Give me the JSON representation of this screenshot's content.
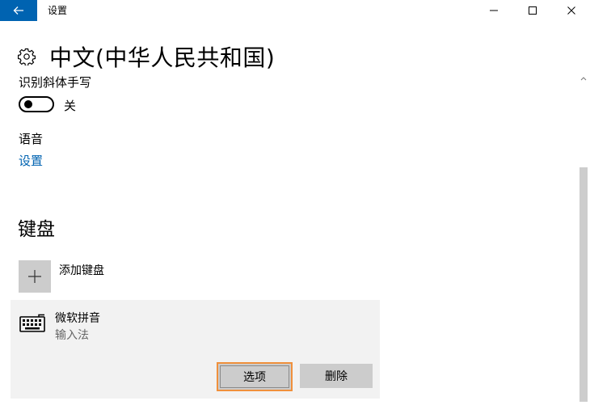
{
  "window": {
    "title": "设置",
    "back_icon": "arrow-left-icon",
    "controls": [
      "minimize-icon",
      "maximize-icon",
      "close-icon"
    ],
    "accent": "#0063b1"
  },
  "page": {
    "icon": "gear-icon",
    "title": "中文(中华人民共和国)"
  },
  "handwriting": {
    "label": "识别斜体手写",
    "toggle_state": "关"
  },
  "speech": {
    "label": "语音",
    "link": "设置"
  },
  "keyboard": {
    "heading": "键盘",
    "add_label": "添加键盘",
    "item": {
      "name": "微软拼音",
      "type": "输入法",
      "options_button": "选项",
      "delete_button": "删除"
    }
  }
}
